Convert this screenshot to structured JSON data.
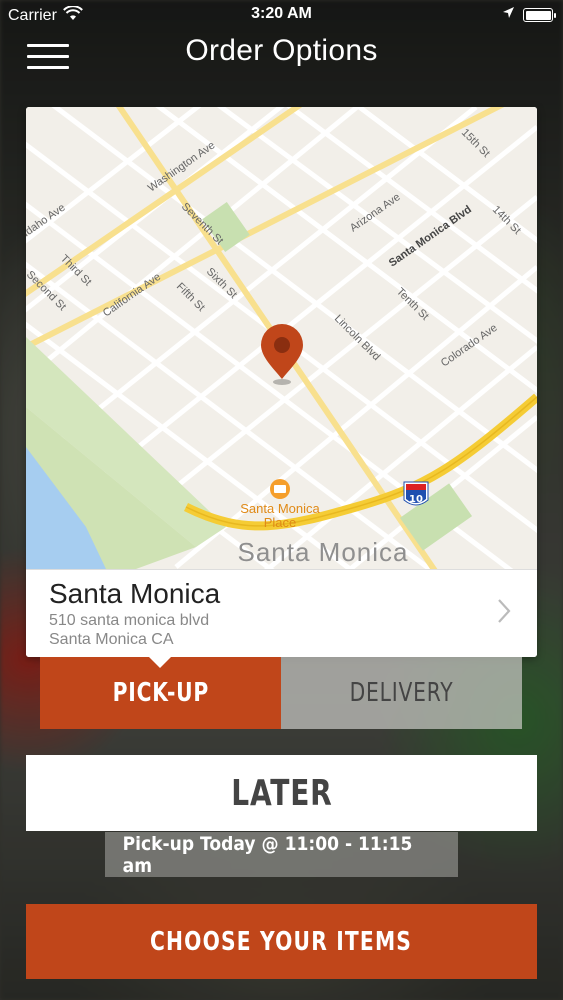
{
  "status_bar": {
    "carrier": "Carrier",
    "time": "3:20 AM",
    "wifi_icon": "wifi-icon",
    "location_icon": "location-arrow-icon",
    "battery_icon": "battery-icon"
  },
  "nav": {
    "title": "Order Options",
    "menu_icon": "hamburger-menu-icon"
  },
  "map": {
    "streets": [
      "Idaho Ave",
      "Washington Ave",
      "Seventh St",
      "Third St",
      "Second St",
      "California Ave",
      "Fifth St",
      "Sixth St",
      "Arizona Ave",
      "Santa Monica Blvd",
      "Lincoln Blvd",
      "Tenth St",
      "14th St",
      "15th St",
      "Colorado Ave"
    ],
    "poi_name": "Santa Monica\nPlace",
    "city_label": "Santa Monica",
    "highway_shield": "10",
    "pin_color": "#c0461a"
  },
  "location": {
    "name": "Santa Monica",
    "address_line1": "510 santa monica blvd",
    "address_line2": "Santa Monica CA"
  },
  "order_type": {
    "pickup_label": "PICK-UP",
    "delivery_label": "DELIVERY",
    "selected": "PICK-UP"
  },
  "timing": {
    "later_label": "LATER",
    "pickup_time_text": "Pick-up Today @ 11:00 - 11:15 am"
  },
  "cta": {
    "choose_items_label": "CHOOSE YOUR ITEMS"
  },
  "colors": {
    "accent": "#c0461a"
  }
}
